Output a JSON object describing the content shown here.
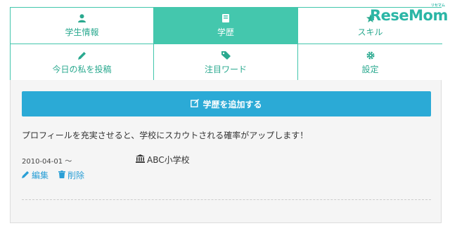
{
  "tabs": [
    {
      "label": "学生情報",
      "icon": "person-icon",
      "active": false
    },
    {
      "label": "学歴",
      "icon": "book-icon",
      "active": true
    },
    {
      "label": "スキル",
      "icon": "star-icon",
      "active": false
    },
    {
      "label": "今日の私を投稿",
      "icon": "pencil-icon",
      "active": false
    },
    {
      "label": "注目ワード",
      "icon": "tag-icon",
      "active": false
    },
    {
      "label": "設定",
      "icon": "gear-icon",
      "active": false
    }
  ],
  "add_button": {
    "label": "学歴を追加する",
    "icon": "edit-square-icon"
  },
  "message": "プロフィールを充実させると、学校にスカウトされる確率がアップします！",
  "entry": {
    "date": "2010-04-01 〜",
    "school": "ABC小学校",
    "edit_label": "編集",
    "delete_label": "削除"
  },
  "watermark": {
    "text": "ReseMom",
    "kana": "リセマム"
  },
  "colors": {
    "accent": "#44c7ad",
    "button": "#2baad6",
    "link": "#2a9fd6"
  }
}
